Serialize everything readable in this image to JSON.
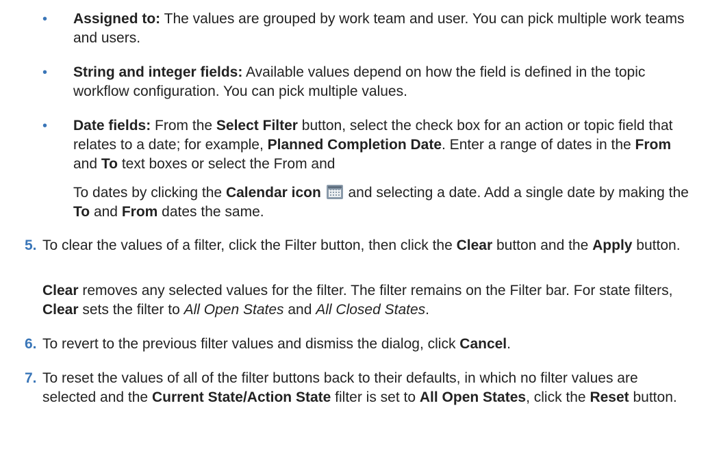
{
  "bullets": [
    {
      "term": "Assigned to:",
      "text": " The values are grouped by work team and user. You can pick multiple work teams and users."
    },
    {
      "term": "String and integer fields:",
      "text": " Available values depend on how the field is defined in the topic workflow configuration. You can pick multiple values."
    },
    {
      "term": "Date fields:",
      "t1": " From the ",
      "b1": "Select Filter",
      "t2": " button, select the check box for an action or topic field that relates to a date; for example, ",
      "b2": "Planned Completion Date",
      "t3": ". Enter a range of dates in the ",
      "b3": "From",
      "t4": " and ",
      "b4": "To",
      "t5": " text boxes or select the From and",
      "t6": "To dates by clicking the ",
      "b5": "Calendar icon",
      "icon": "calendar-icon",
      "t7": " and selecting a date. Add a single date by making the ",
      "b6": "To",
      "t8": " and ",
      "b7": "From",
      "t9": " dates the same."
    }
  ],
  "steps": [
    {
      "number": "5.",
      "t1": "To clear the values of a filter, click the Filter button, then click the ",
      "b1": "Clear",
      "t2": " button and the ",
      "b2": "Apply",
      "t3": " button.",
      "note": {
        "b1": "Clear",
        "t1": " removes any selected values for the filter. The filter remains on the Filter bar. For state filters, ",
        "b2": "Clear",
        "t2": " sets the filter to ",
        "i1": "All Open States",
        "t3": " and ",
        "i2": "All Closed States",
        "t4": "."
      }
    },
    {
      "number": "6.",
      "t1": "To revert to the previous filter values and dismiss the dialog, click ",
      "b1": "Cancel",
      "t2": "."
    },
    {
      "number": "7.",
      "t1": "To reset the values of all of the filter buttons back to their defaults, in which no filter values are selected and the ",
      "b1": "Current State/Action State",
      "t2": " filter is set to ",
      "b2": "All Open States",
      "t3": ", click the ",
      "b3": "Reset",
      "t4": " button."
    }
  ]
}
